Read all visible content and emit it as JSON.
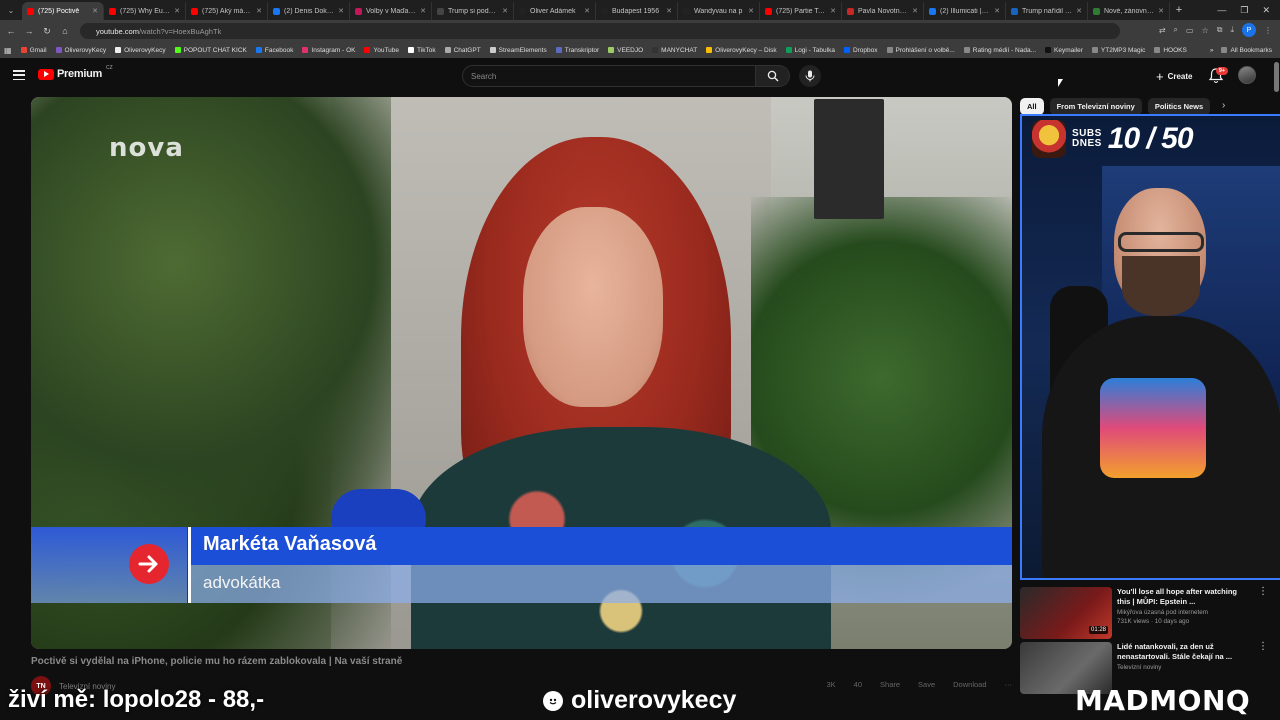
{
  "browser": {
    "tabs": [
      {
        "title": "(725) Poctivě",
        "active": true,
        "color": "#ff0000"
      },
      {
        "title": "(725) Why Europe",
        "color": "#ff0000"
      },
      {
        "title": "(725) Aký má ST",
        "color": "#ff0000"
      },
      {
        "title": "(2) Denis Doksan",
        "color": "#1877f2"
      },
      {
        "title": "Volby v Maďarsk",
        "color": "#c2185b"
      },
      {
        "title": "Trump si podpor",
        "color": "#444"
      },
      {
        "title": "Oliver Adámek",
        "color": "#222"
      },
      {
        "title": "Budapest 1956",
        "color": "#222"
      },
      {
        "title": "Wandyvau na p",
        "color": "#222"
      },
      {
        "title": "(725) Partie Terez",
        "color": "#ff0000"
      },
      {
        "title": "Pavla Novotného",
        "color": "#c62828"
      },
      {
        "title": "(2) Illumicati | Fa",
        "color": "#1877f2"
      },
      {
        "title": "Trump nařídil ná",
        "color": "#1565c0"
      },
      {
        "title": "Nové, zánovní a",
        "color": "#2e7d32"
      }
    ],
    "url_host": "youtube.com",
    "url_path": "/watch?v=HoexBuAghTk",
    "bookmarks": [
      {
        "label": "Gmail",
        "color": "#ea4335"
      },
      {
        "label": "OliverovyKecy",
        "color": "#7e57c2"
      },
      {
        "label": "OliverovyKecy",
        "color": "#eee"
      },
      {
        "label": "POPOUT CHAT KICK",
        "color": "#53fc18"
      },
      {
        "label": "Facebook",
        "color": "#1877f2"
      },
      {
        "label": "Instagram - OK",
        "color": "#e1306c"
      },
      {
        "label": "YouTube",
        "color": "#ff0000"
      },
      {
        "label": "TikTok",
        "color": "#fff"
      },
      {
        "label": "ChatGPT",
        "color": "#aaa"
      },
      {
        "label": "StreamElements",
        "color": "#ccc"
      },
      {
        "label": "Transkriptor",
        "color": "#5c6bc0"
      },
      {
        "label": "VEEDJO",
        "color": "#9ccc65"
      },
      {
        "label": "MANYCHAT",
        "color": "#333"
      },
      {
        "label": "OliverovyKecy – Disk",
        "color": "#fbbc04"
      },
      {
        "label": "Logi - Tabulka",
        "color": "#0f9d58"
      },
      {
        "label": "Dropbox",
        "color": "#0061ff"
      },
      {
        "label": "Prohlášení o volbě...",
        "color": "#888"
      },
      {
        "label": "Rating médií - Nada...",
        "color": "#888"
      },
      {
        "label": "Keymailer",
        "color": "#111"
      },
      {
        "label": "YT2MP3 Magic",
        "color": "#888"
      },
      {
        "label": "HOOKS",
        "color": "#888"
      }
    ],
    "all_bookmarks": "All Bookmarks"
  },
  "youtube": {
    "logo_text": "Premium",
    "logo_region": "CZ",
    "search_placeholder": "Search",
    "create_label": "Create",
    "notifications_badge": "9+"
  },
  "video": {
    "watermark": "nova",
    "lower_third_name": "Markéta Vaňasová",
    "lower_third_role": "advokátka",
    "title": "Poctivě si vydělal na iPhone, policie mu ho rázem zablokovala | Na vaší straně",
    "channel_initials": "TN",
    "channel_name": "Televizní noviny",
    "actions": [
      "3K",
      "40",
      "Share",
      "Save",
      "Download",
      "···"
    ]
  },
  "sidebar": {
    "chips": [
      {
        "label": "All",
        "active": true
      },
      {
        "label": "From Televizní noviny",
        "active": false
      },
      {
        "label": "Politics News",
        "active": false
      }
    ],
    "subs_label_1": "SUBS",
    "subs_label_2": "DNES",
    "subs_count": "10 / 50",
    "recommendations": [
      {
        "title": "You'll lose all hope after watching this | MŮPI: Epstein ...",
        "channel": "Mikýřova úzasná pod internetem",
        "meta": "731K views · 10 days ago",
        "duration": "01:28"
      },
      {
        "title": "Lidé natankovali, za den už nenastartovali. Stále čekají na ...",
        "channel": "Televizní noviny",
        "meta": "",
        "duration": ""
      }
    ]
  },
  "stream_overlay": {
    "left_text": "živí mě: lopolo28 - 88,-",
    "mid_text": "oliverovykecy",
    "right_text": "MADMONQ"
  }
}
